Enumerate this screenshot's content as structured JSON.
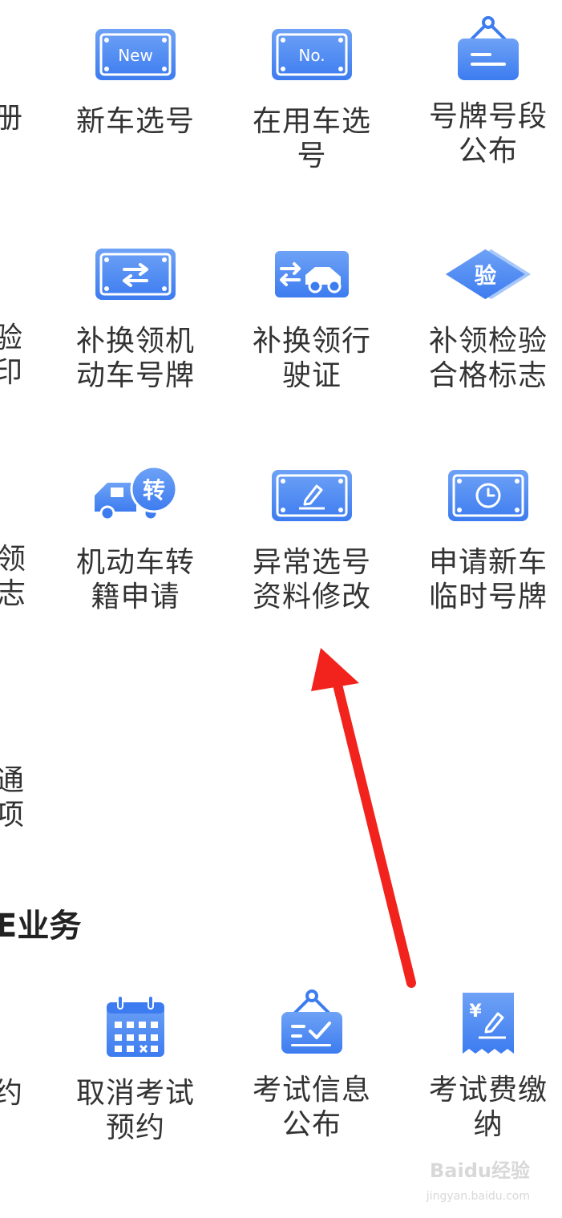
{
  "rows": [
    {
      "left_fragment": "册",
      "tiles": [
        {
          "label": "新车选号",
          "icon": "new-plate-icon",
          "icon_text": "New"
        },
        {
          "label": "在用车选号",
          "icon": "number-plate-icon",
          "icon_text": "No."
        },
        {
          "label": "号牌号段\n公布",
          "icon": "notice-board-icon"
        }
      ]
    },
    {
      "left_fragment": "验\n印",
      "tiles": [
        {
          "label": "补换领机\n动车号牌",
          "icon": "plate-exchange-icon"
        },
        {
          "label": "补换领行\n驶证",
          "icon": "license-exchange-icon"
        },
        {
          "label": "补领检验\n合格标志",
          "icon": "inspection-badge-icon",
          "icon_text": "验"
        }
      ]
    },
    {
      "left_fragment": "领\n志",
      "tiles": [
        {
          "label": "机动车转\n籍申请",
          "icon": "transfer-truck-icon",
          "icon_text": "转"
        },
        {
          "label": "异常选号\n资料修改",
          "icon": "edit-plate-icon"
        },
        {
          "label": "申请新车\n临时号牌",
          "icon": "temporary-plate-icon"
        }
      ]
    }
  ],
  "orphan_fragment": "通\n项",
  "section": {
    "title": "E业务"
  },
  "exam_row": {
    "left_fragment": "约",
    "tiles": [
      {
        "label": "取消考试\n预约",
        "icon": "calendar-cancel-icon"
      },
      {
        "label": "考试信息\n公布",
        "icon": "exam-notice-icon"
      },
      {
        "label": "考试费缴纳",
        "icon": "fee-payment-icon"
      }
    ]
  },
  "watermark": {
    "text": "Baidu经验",
    "sub": "jingyan.baidu.com"
  },
  "colors": {
    "icon_blue": "#3d7cf0",
    "icon_light": "#6ea2f6",
    "arrow_red": "#f2231d"
  }
}
